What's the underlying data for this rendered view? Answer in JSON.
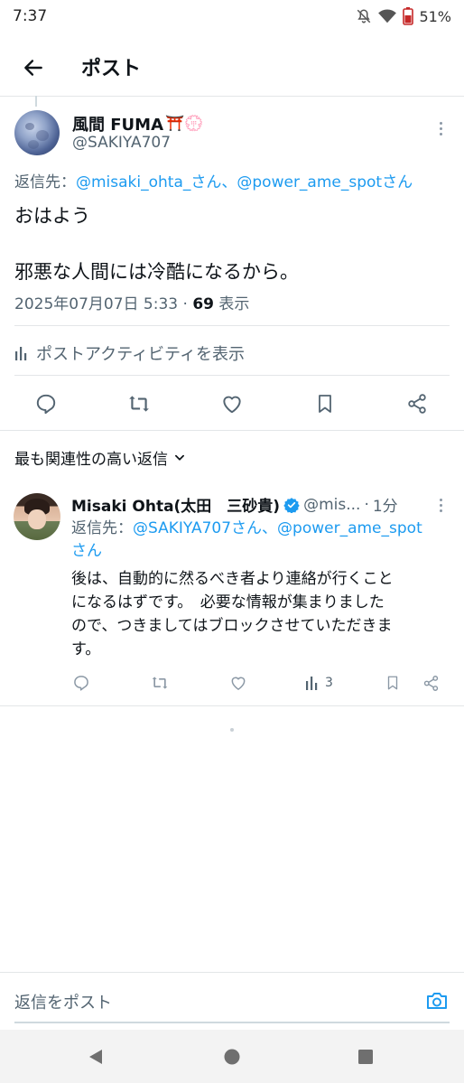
{
  "status_bar": {
    "time": "7:37",
    "battery": "51%",
    "icons": [
      "bell-off-icon",
      "wifi-icon",
      "battery-icon"
    ]
  },
  "header": {
    "title": "ポスト",
    "back_icon": "arrow-left-icon"
  },
  "post": {
    "author_name": "風間 FUMA",
    "author_emoji": "⛩️💮",
    "author_handle": "@SAKIYA707",
    "reply_prefix": "返信先：",
    "reply_targets": "@misaki_ohta_さん、@power_ame_spotさん",
    "text_line1": "おはよう",
    "text_line2": "邪悪な人間には冷酷になるから。",
    "date": "2025年07月07日 5:33 · ",
    "views_count": "69",
    "views_label": " 表示",
    "activity_label": "ポストアクティビティを表示"
  },
  "sort": {
    "label": "最も関連性の高い返信"
  },
  "reply": {
    "name": "Misaki Ohta(太田　三砂貴)",
    "handle": "@mis...",
    "dot": "·",
    "time": "1分",
    "reply_prefix": "返信先：",
    "reply_targets_line1": "@SAKIYA707さん、@power_ame_spot",
    "reply_targets_line2": "さん",
    "body_line1": "後は、自動的に然るべき者より連絡が行くこと",
    "body_line2": "になるはずです。　必要な情報が集まりました",
    "body_line3": "ので、つきましてはブロックさせていただきま",
    "body_line4": "す。",
    "views_count": "3"
  },
  "compose": {
    "placeholder": "返信をポスト"
  },
  "colors": {
    "accent": "#1d9bf0",
    "text": "#0f1419",
    "secondary": "#536471",
    "divider": "#e3e6e8"
  }
}
